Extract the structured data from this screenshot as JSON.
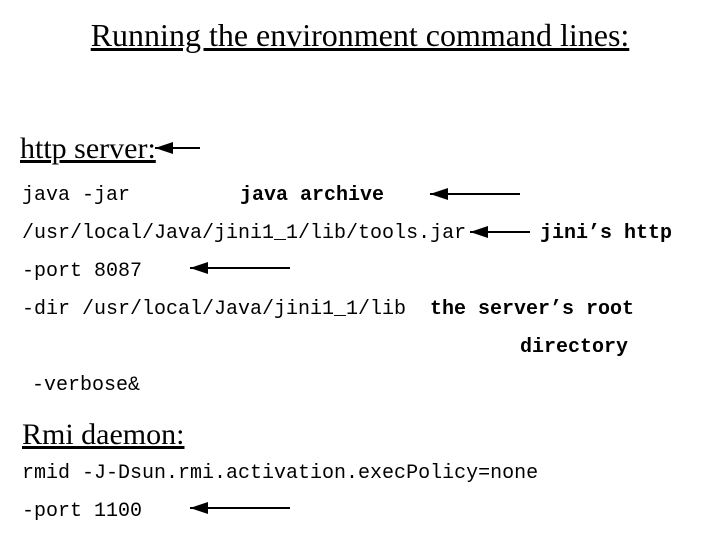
{
  "title": "Running the environment command lines:",
  "section1": "http server:",
  "line1": "java -jar",
  "annot1": "java archive",
  "line2": "/usr/local/Java/jini1_1/lib/tools.jar",
  "annot2": "jini’s http",
  "line3": "-port 8087",
  "line4": "-dir /usr/local/Java/jini1_1/lib",
  "annot3": "the server’s root",
  "annot3b": "directory",
  "line5": "-verbose&",
  "section2": "Rmi daemon:",
  "line6": "rmid -J-Dsun.rmi.activation.execPolicy=none",
  "line7": "-port 1100"
}
